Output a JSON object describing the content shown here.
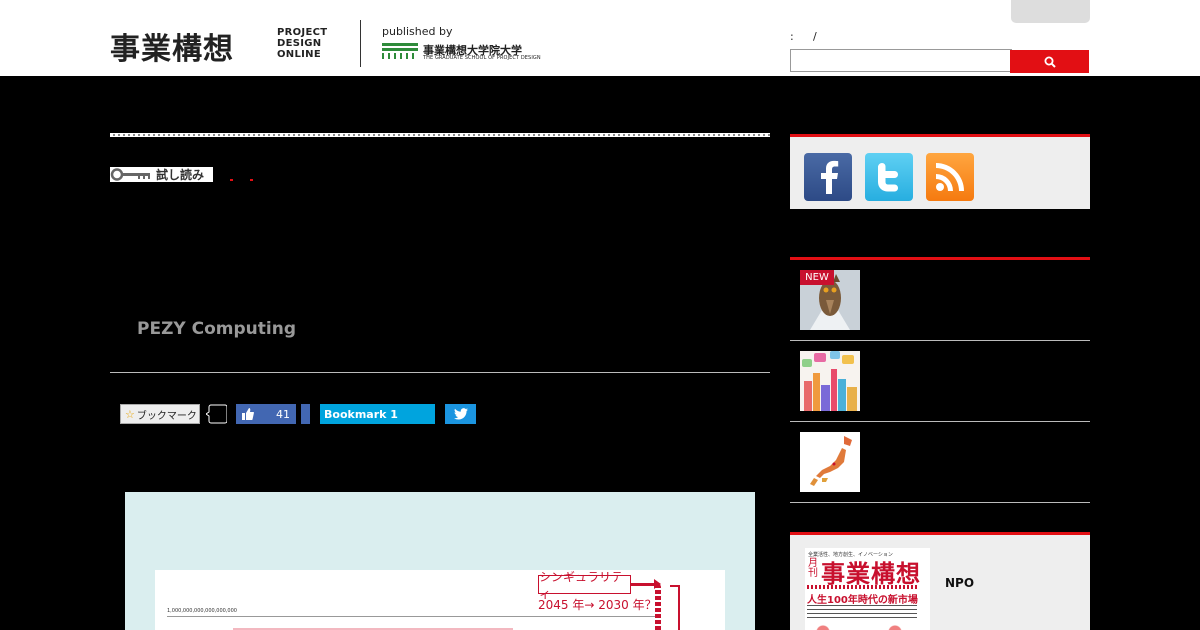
{
  "header": {
    "logo_jp": "事業構想",
    "logo_en_lines": [
      "PROJECT",
      "DESIGN",
      "ONLINE"
    ],
    "published_by": "published by",
    "graduate_school_jp": "事業構想大学院大学",
    "graduate_school_en": "THE GRADUATE SCHOOL OF PROJECT DESIGN",
    "date_separator": ":",
    "date_slash": "/",
    "search": {
      "placeholder": "",
      "value": ""
    }
  },
  "article": {
    "trial_label": "試し読み",
    "title": "PEZY Computing",
    "share": {
      "bookmark_jp": "ブックマーク",
      "like_count": "41",
      "hatena_label": "Bookmark 1"
    },
    "figure": {
      "axis_label": "1,000,000,000,000,000,000",
      "singularity_label": "シンギュラリティ",
      "singularity_years": "2045 年→ 2030 年？"
    }
  },
  "sidebar": {
    "social": [
      {
        "name": "facebook-icon"
      },
      {
        "name": "twitter-icon"
      },
      {
        "name": "rss-icon"
      }
    ],
    "new_badge": "NEW",
    "magazine": {
      "small_text": "全業活性、地方創生、イノベーション",
      "month_label": "月刊",
      "title": "事業構想",
      "headline": "人生100年時代の新市場",
      "side_label": "NPO"
    }
  },
  "colors": {
    "accent": "#e20f14",
    "facebook": "#4267b2",
    "hatena": "#00a4de",
    "twitter": "#1b95e0"
  }
}
